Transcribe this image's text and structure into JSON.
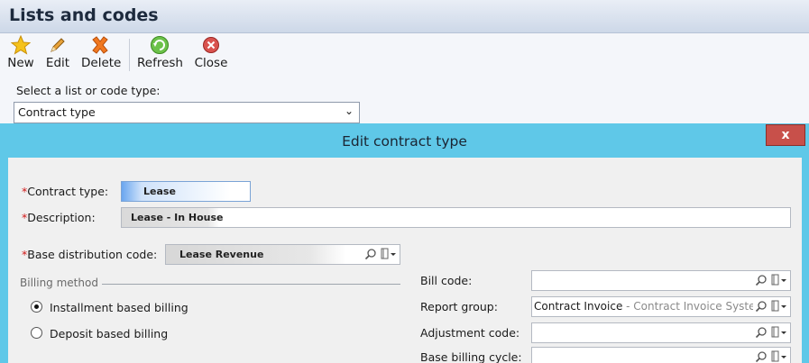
{
  "window": {
    "title": "Lists and codes"
  },
  "toolbar": {
    "new_label": "New",
    "edit_label": "Edit",
    "delete_label": "Delete",
    "refresh_label": "Refresh",
    "close_label": "Close"
  },
  "selector": {
    "label": "Select a list or code type:",
    "value": "Contract type"
  },
  "dialog": {
    "title": "Edit contract type",
    "close_label": "x",
    "contract_type_label": "Contract type:",
    "contract_type_value": "Lease",
    "description_label": "Description:",
    "description_value": "Lease - In House",
    "base_dist_label": "Base distribution code:",
    "base_dist_value": "Lease Revenue",
    "billing_method_title": "Billing method",
    "billing_options": [
      "Installment based billing",
      "Deposit based billing"
    ],
    "selected_billing": "Installment based billing",
    "bill_code_label": "Bill code:",
    "bill_code_value": "",
    "report_group_label": "Report group:",
    "report_group_value": "Contract Invoice",
    "report_group_desc": " - Contract Invoice System",
    "adjustment_code_label": "Adjustment code:",
    "adjustment_code_value": "",
    "base_billing_cycle_label": "Base billing cycle:",
    "base_billing_cycle_value": ""
  },
  "colors": {
    "dialog_frame": "#5fc8e8",
    "required_star": "#d01818",
    "close_button": "#c8504a"
  }
}
